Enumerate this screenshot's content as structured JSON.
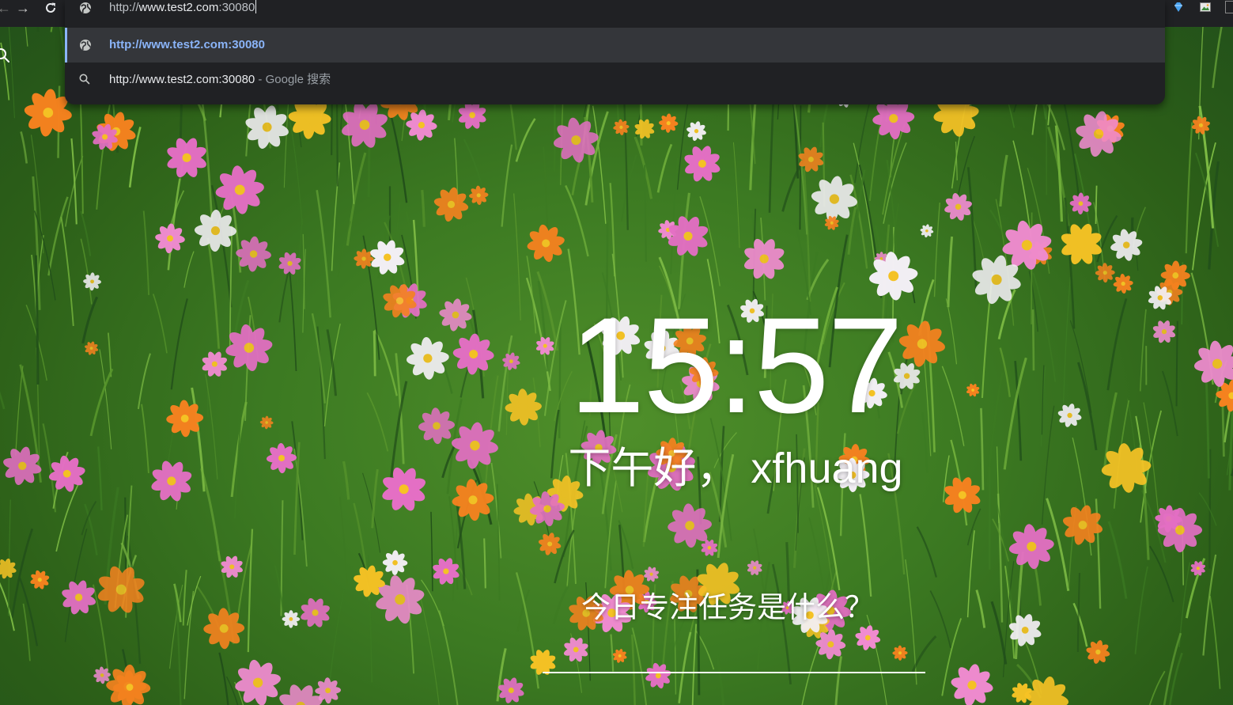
{
  "browser": {
    "nav": {
      "back_glyph": "←",
      "forward_glyph": "→",
      "reload_glyph": "⟳"
    },
    "omnibox": {
      "typed_scheme": "http://",
      "typed_host": "www.test2.com",
      "typed_port": ":30080",
      "suggestions": [
        {
          "icon": "globe-icon",
          "text": "http://www.test2.com:30080"
        },
        {
          "icon": "search-icon",
          "text": "http://www.test2.com:30080",
          "separator": " - ",
          "suffix": "Google 搜索"
        }
      ]
    },
    "extension_icons": [
      "gem-extension-icon",
      "image-extension-icon"
    ]
  },
  "dashboard": {
    "clock": "15:57",
    "greeting": "下午好， xfhuang",
    "focus_question": "今日专注任务是什么？",
    "focus_input_value": ""
  },
  "background": {
    "subject": "meadow of cosmos flowers",
    "colors": {
      "grass_dark": "#22501a",
      "grass_mid": "#3c7a22",
      "grass_light": "#6fae3a",
      "orange": "#f5821f",
      "pink": "#e46fc4",
      "white": "#f4f0f6",
      "yellow": "#f7c325"
    }
  }
}
